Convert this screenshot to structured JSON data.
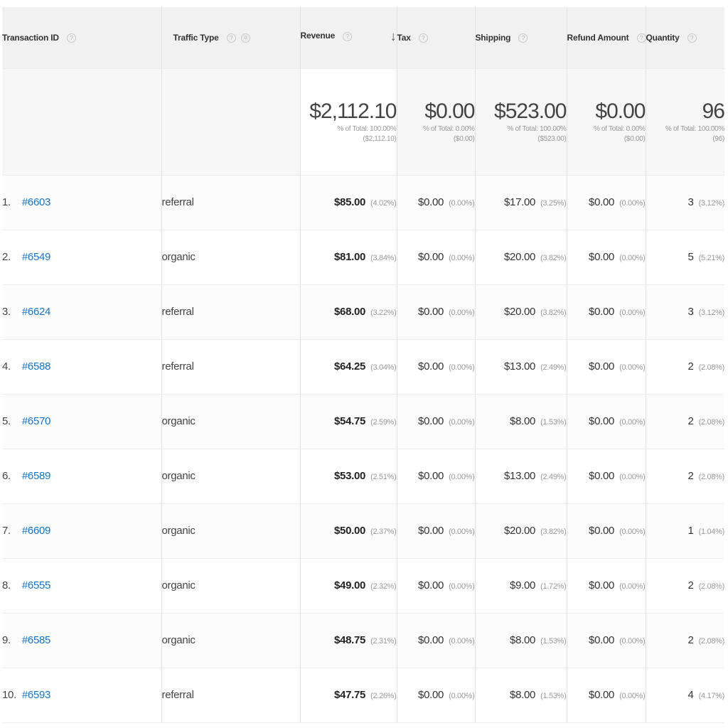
{
  "columns": {
    "transaction_id": "Transaction ID",
    "traffic_type": "Traffic Type",
    "revenue": "Revenue",
    "tax": "Tax",
    "shipping": "Shipping",
    "refund_amount": "Refund Amount",
    "quantity": "Quantity"
  },
  "icons": {
    "help": "?",
    "segment": "⓪",
    "sort_desc": "↓"
  },
  "totals": {
    "revenue": {
      "value": "$2,112.10",
      "pct": "% of Total: 100.00%",
      "abs": "($2,112.10)"
    },
    "tax": {
      "value": "$0.00",
      "pct": "% of Total: 0.00%",
      "abs": "($0.00)"
    },
    "shipping": {
      "value": "$523.00",
      "pct": "% of Total: 100.00%",
      "abs": "($523.00)"
    },
    "refund_amount": {
      "value": "$0.00",
      "pct": "% of Total: 0.00%",
      "abs": "($0.00)"
    },
    "quantity": {
      "value": "96",
      "pct": "% of Total: 100.00%",
      "abs": "(96)"
    }
  },
  "rows": [
    {
      "num": "1.",
      "id": "#6603",
      "type": "referral",
      "revenue": "$85.00",
      "revenue_pct": "(4.02%)",
      "tax": "$0.00",
      "tax_pct": "(0.00%)",
      "shipping": "$17.00",
      "shipping_pct": "(3.25%)",
      "refund": "$0.00",
      "refund_pct": "(0.00%)",
      "qty": "3",
      "qty_pct": "(3.12%)"
    },
    {
      "num": "2.",
      "id": "#6549",
      "type": "organic",
      "revenue": "$81.00",
      "revenue_pct": "(3.84%)",
      "tax": "$0.00",
      "tax_pct": "(0.00%)",
      "shipping": "$20.00",
      "shipping_pct": "(3.82%)",
      "refund": "$0.00",
      "refund_pct": "(0.00%)",
      "qty": "5",
      "qty_pct": "(5.21%)"
    },
    {
      "num": "3.",
      "id": "#6624",
      "type": "referral",
      "revenue": "$68.00",
      "revenue_pct": "(3.22%)",
      "tax": "$0.00",
      "tax_pct": "(0.00%)",
      "shipping": "$20.00",
      "shipping_pct": "(3.82%)",
      "refund": "$0.00",
      "refund_pct": "(0.00%)",
      "qty": "3",
      "qty_pct": "(3.12%)"
    },
    {
      "num": "4.",
      "id": "#6588",
      "type": "referral",
      "revenue": "$64.25",
      "revenue_pct": "(3.04%)",
      "tax": "$0.00",
      "tax_pct": "(0.00%)",
      "shipping": "$13.00",
      "shipping_pct": "(2.49%)",
      "refund": "$0.00",
      "refund_pct": "(0.00%)",
      "qty": "2",
      "qty_pct": "(2.08%)"
    },
    {
      "num": "5.",
      "id": "#6570",
      "type": "organic",
      "revenue": "$54.75",
      "revenue_pct": "(2.59%)",
      "tax": "$0.00",
      "tax_pct": "(0.00%)",
      "shipping": "$8.00",
      "shipping_pct": "(1.53%)",
      "refund": "$0.00",
      "refund_pct": "(0.00%)",
      "qty": "2",
      "qty_pct": "(2.08%)"
    },
    {
      "num": "6.",
      "id": "#6589",
      "type": "organic",
      "revenue": "$53.00",
      "revenue_pct": "(2.51%)",
      "tax": "$0.00",
      "tax_pct": "(0.00%)",
      "shipping": "$13.00",
      "shipping_pct": "(2.49%)",
      "refund": "$0.00",
      "refund_pct": "(0.00%)",
      "qty": "2",
      "qty_pct": "(2.08%)"
    },
    {
      "num": "7.",
      "id": "#6609",
      "type": "organic",
      "revenue": "$50.00",
      "revenue_pct": "(2.37%)",
      "tax": "$0.00",
      "tax_pct": "(0.00%)",
      "shipping": "$20.00",
      "shipping_pct": "(3.82%)",
      "refund": "$0.00",
      "refund_pct": "(0.00%)",
      "qty": "1",
      "qty_pct": "(1.04%)"
    },
    {
      "num": "8.",
      "id": "#6555",
      "type": "organic",
      "revenue": "$49.00",
      "revenue_pct": "(2.32%)",
      "tax": "$0.00",
      "tax_pct": "(0.00%)",
      "shipping": "$9.00",
      "shipping_pct": "(1.72%)",
      "refund": "$0.00",
      "refund_pct": "(0.00%)",
      "qty": "2",
      "qty_pct": "(2.08%)"
    },
    {
      "num": "9.",
      "id": "#6585",
      "type": "organic",
      "revenue": "$48.75",
      "revenue_pct": "(2.31%)",
      "tax": "$0.00",
      "tax_pct": "(0.00%)",
      "shipping": "$8.00",
      "shipping_pct": "(1.53%)",
      "refund": "$0.00",
      "refund_pct": "(0.00%)",
      "qty": "2",
      "qty_pct": "(2.08%)"
    },
    {
      "num": "10.",
      "id": "#6593",
      "type": "referral",
      "revenue": "$47.75",
      "revenue_pct": "(2.26%)",
      "tax": "$0.00",
      "tax_pct": "(0.00%)",
      "shipping": "$8.00",
      "shipping_pct": "(1.53%)",
      "refund": "$0.00",
      "refund_pct": "(0.00%)",
      "qty": "4",
      "qty_pct": "(4.17%)"
    }
  ],
  "colors": {
    "link": "#1a73c9",
    "header_bg": "#f1f1f1",
    "summary_bg": "#f6f6f6"
  }
}
